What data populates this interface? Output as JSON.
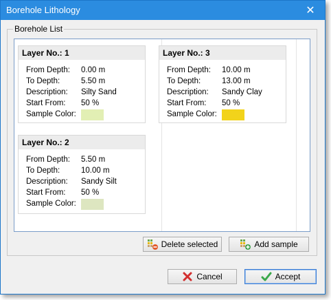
{
  "window": {
    "title": "Borehole Lithology",
    "close_glyph": "✕"
  },
  "group": {
    "label": "Borehole List"
  },
  "field_labels": {
    "from_depth": "From Depth:",
    "to_depth": "To Depth:",
    "description": "Description:",
    "start_from": "Start From:",
    "sample_color": "Sample Color:"
  },
  "layers": [
    {
      "header": "Layer No.: 1",
      "from_depth": "0.00 m",
      "to_depth": "5.50 m",
      "description": "Silty Sand",
      "start_from": "50 %",
      "color": "#e2efb4"
    },
    {
      "header": "Layer No.: 2",
      "from_depth": "5.50 m",
      "to_depth": "10.00 m",
      "description": "Sandy Silt",
      "start_from": "50 %",
      "color": "#dde6c0"
    },
    {
      "header": "Layer No.: 3",
      "from_depth": "10.00 m",
      "to_depth": "13.00 m",
      "description": "Sandy Clay",
      "start_from": "50 %",
      "color": "#f2d31b"
    }
  ],
  "buttons": {
    "delete_selected": "Delete selected",
    "add_sample": "Add sample",
    "cancel": "Cancel",
    "accept": "Accept"
  },
  "icons": {
    "delete": "delete-sample-icon",
    "add": "add-sample-icon",
    "cancel": "red-x-icon",
    "accept": "green-check-icon"
  }
}
